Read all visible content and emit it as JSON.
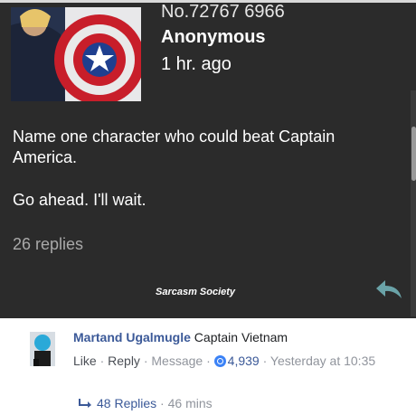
{
  "post": {
    "number": "No.72767 6966",
    "author": "Anonymous",
    "time": "1 hr. ago",
    "text1": "Name one character who could beat Captain America.",
    "text2": "Go ahead. I'll wait.",
    "replies": "26 replies",
    "watermark": "Sarcasm Society"
  },
  "comment": {
    "author": "Martand Ugalmugle",
    "text": "Captain Vietnam",
    "like": "Like",
    "reply": "Reply",
    "message": "Message",
    "sep": "·",
    "reaction_count": "4,939",
    "timestamp": "Yesterday at 10:35",
    "replies_label": "48 Replies",
    "replies_time": "46 mins"
  },
  "colors": {
    "post_bg": "#2b2b2b",
    "link_blue": "#3b5998",
    "share_teal": "#6aa3a8"
  }
}
